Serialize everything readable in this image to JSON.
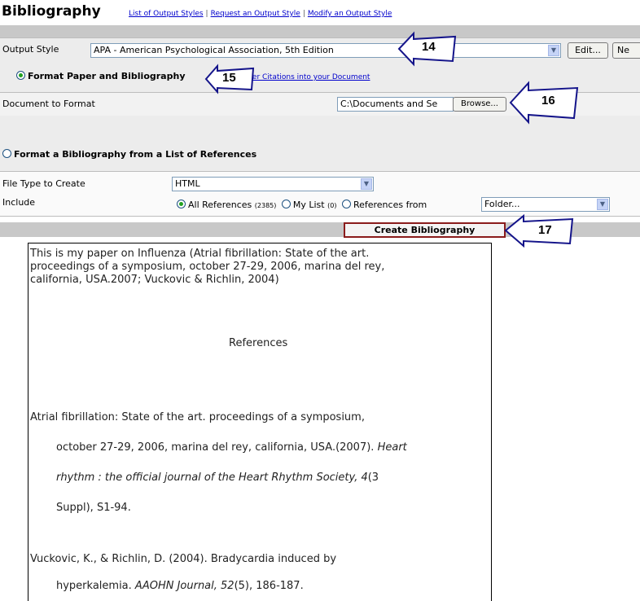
{
  "header": {
    "title": "Bibliography",
    "links": [
      "List of Output Styles",
      "Request an Output Style",
      "Modify an Output Style"
    ],
    "separator": "|"
  },
  "output_style": {
    "label": "Output Style",
    "value": "APA - American Psychological Association, 5th Edition",
    "edit_label": "Edit...",
    "new_label": "Ne"
  },
  "format_paper": {
    "option_label": "Format Paper and Bibliography",
    "help_link": "Enter Citations into your Document",
    "doc_label": "Document to Format",
    "doc_value": "C:\\Documents and Se",
    "browse_label": "Browse..."
  },
  "format_list": {
    "option_label": "Format a Bibliography from a List of References",
    "file_type_label": "File Type to Create",
    "file_type_value": "HTML",
    "include_label": "Include",
    "all_refs_label": "All References",
    "all_refs_count": "(2385)",
    "my_list_label": "My List",
    "my_list_count": "(0)",
    "refs_from_label": "References from",
    "folder_value": "Folder..."
  },
  "create_button": "Create Bibliography",
  "callouts": [
    "14",
    "15",
    "16",
    "17"
  ],
  "preview": {
    "intro": [
      "This is my paper on Influenza (Atrial fibrillation: State of the art.",
      "proceedings of a symposium, october 27-29, 2006, marina del rey,",
      "california, USA.2007; Vuckovic & Richlin, 2004)"
    ],
    "heading": "References",
    "ref1": {
      "line1": "Atrial fibrillation: State of the art. proceedings of a symposium,",
      "line2_plain": "october 27-29, 2006, marina del rey, california, USA.(2007). ",
      "line2_italic": "Heart",
      "line3_italic": "rhythm : the official journal of the Heart Rhythm Society, 4",
      "line3_plain": "(3",
      "line4": "Suppl), S1-94."
    },
    "ref2": {
      "line1": "Vuckovic, K., & Richlin, D. (2004). Bradycardia induced by",
      "line2_plain_a": "hyperkalemia. ",
      "line2_italic": "AAOHN Journal, 52",
      "line2_plain_b": "(5), 186-187."
    }
  },
  "colors": {
    "link": "#0000cc",
    "panel": "#ececec",
    "band": "#c8c8c8",
    "radio_selected": "#21a121"
  }
}
